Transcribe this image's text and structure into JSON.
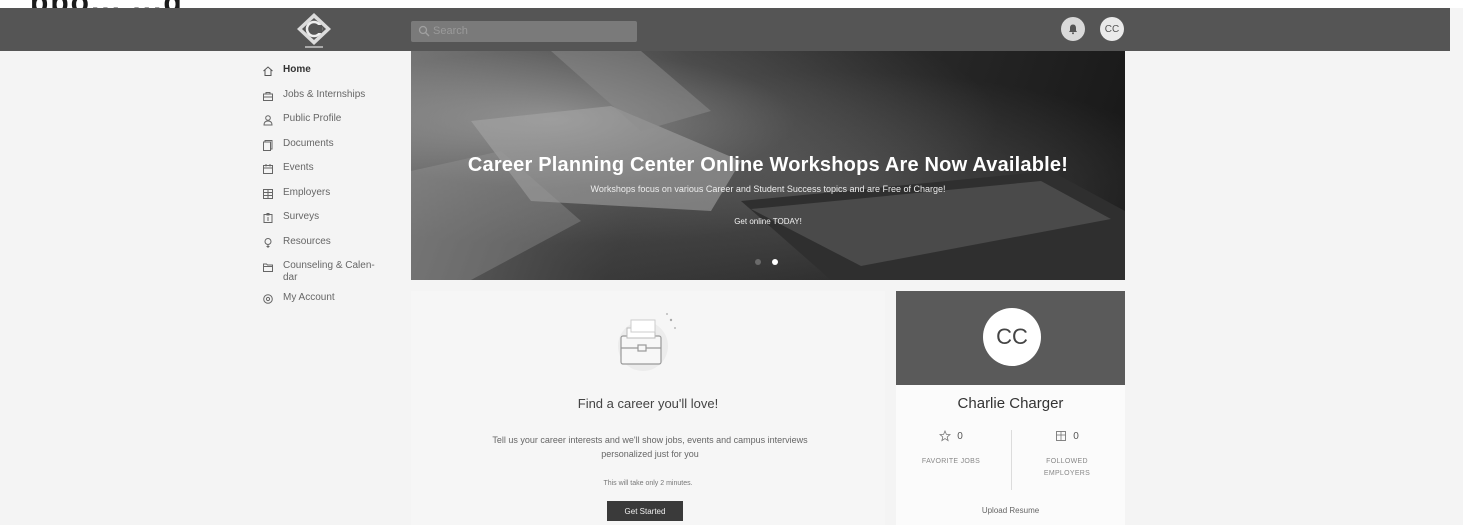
{
  "top_strip": {
    "text": "ppo... ...g"
  },
  "search": {
    "placeholder": "Search"
  },
  "user": {
    "initials": "CC",
    "name": "Charlie Charger"
  },
  "sidebar": {
    "items": [
      {
        "label": "Home",
        "icon": "home-icon",
        "active": true
      },
      {
        "label": "Jobs & Internships",
        "icon": "briefcase-icon"
      },
      {
        "label": "Public Profile",
        "icon": "person-icon"
      },
      {
        "label": "Documents",
        "icon": "documents-icon"
      },
      {
        "label": "Events",
        "icon": "calendar-icon"
      },
      {
        "label": "Employers",
        "icon": "building-icon"
      },
      {
        "label": "Surveys",
        "icon": "survey-icon"
      },
      {
        "label": "Resources",
        "icon": "lightbulb-icon"
      },
      {
        "label": "Counseling & Calendar",
        "label_line1": "Counseling & Calen-",
        "label_line2": "dar",
        "icon": "folder-icon"
      },
      {
        "label": "My Account",
        "icon": "gear-icon"
      }
    ]
  },
  "hero": {
    "title": "Career Planning Center Online Workshops Are Now Available!",
    "subtitle": "Workshops focus on various Career and Student Success topics and are Free of Charge!",
    "cta": "Get online TODAY!"
  },
  "career_card": {
    "title": "Find a career you'll love!",
    "description": "Tell us your career interests and we'll show jobs, events and campus interviews personalized just for you",
    "note": "This will take only 2 minutes.",
    "button": "Get Started"
  },
  "profile_card": {
    "favorite_jobs": {
      "count": "0",
      "label_line1": "FAVORITE JOBS"
    },
    "followed_employers": {
      "count": "0",
      "label_line1": "FOLLOWED",
      "label_line2": "EMPLOYERS"
    },
    "upload": "Upload Resume"
  },
  "colors": {
    "navbar": "#555555",
    "background": "#f4f4f4",
    "profile_header": "#5a5a5a",
    "button": "#3a3a3a"
  }
}
